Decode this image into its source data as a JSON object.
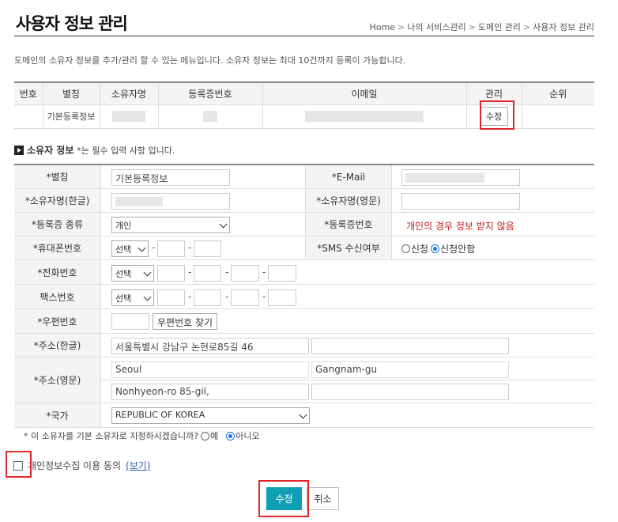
{
  "header": {
    "title": "사용자 정보 관리",
    "breadcrumb": [
      "Home",
      "나의 서비스관리",
      "도메인 관리",
      "사용자 정보 관리"
    ]
  },
  "description": "도메인의 소유자 정보를 추가/관리 할 수 있는 메뉴입니다. 소유자 정보는 최대 10건까지 등록이 가능합니다.",
  "list_table": {
    "headers": [
      "번호",
      "별칭",
      "소유자명",
      "등록증번호",
      "이메일",
      "관리",
      "순위"
    ],
    "row": {
      "alias": "기본등록정보",
      "edit_button": "수정"
    }
  },
  "section": {
    "title": "소유자 정보",
    "note": "*는 필수 입력 사항 입니다."
  },
  "form": {
    "alias_label": "*별칭",
    "alias_value": "기본등록정보",
    "email_label": "*E-Mail",
    "owner_kr_label": "*소유자명(한글)",
    "owner_en_label": "*소유자명(영문)",
    "reg_type_label": "*등록증 종류",
    "reg_type_value": "개인",
    "reg_no_label": "*등록증번호",
    "reg_no_notice": "개인의 경우 정보 받지 않음",
    "mobile_label": "*휴대폰번호",
    "mobile_select": "선택",
    "sms_label": "*SMS 수신여부",
    "sms_yes": "신청",
    "sms_no": "신청안함",
    "phone_label": "*전화번호",
    "phone_select": "선택",
    "fax_label": "팩스번호",
    "fax_select": "선택",
    "zip_label": "*우편번호",
    "zip_button": "우편번호 찾기",
    "addr_kr_label": "*주소(한글)",
    "addr_kr_value": "서울특별시 강남구 논현로85길 46",
    "addr_en_label": "*주소(영문)",
    "addr_en_city": "Seoul",
    "addr_en_district": "Gangnam-gu",
    "addr_en_street": "Nonhyeon-ro 85-gil,",
    "country_label": "*국가",
    "country_value": "REPUBLIC OF KOREA"
  },
  "default_owner": {
    "question": "* 이 소유자를 기본 소유자로 지정하시겠습니까?",
    "yes": "예",
    "no": "아니오"
  },
  "consent": {
    "label": "개인정보수집 이용 동의",
    "view_link": "(보기)"
  },
  "buttons": {
    "submit": "수정",
    "cancel": "취소"
  },
  "colors": {
    "accent": "#0f9fb5",
    "highlight": "#e0262b",
    "notice_red": "#c01818",
    "radio_blue": "#1a73e8"
  }
}
